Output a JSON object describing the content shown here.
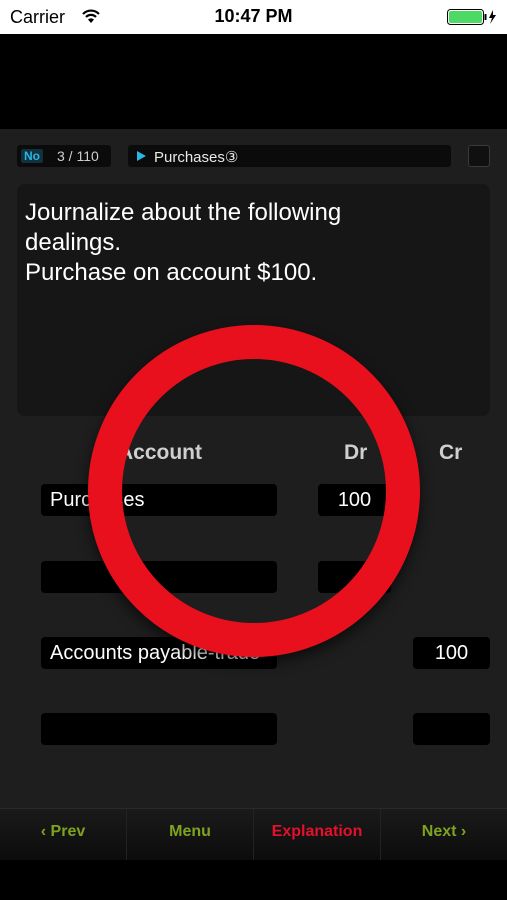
{
  "status_bar": {
    "carrier": "Carrier",
    "time": "10:47 PM"
  },
  "header": {
    "no_label": "No",
    "count": "3 / 110",
    "category": "Purchases③"
  },
  "question": {
    "text": "Journalize about the following\ndealings.\nPurchase on account $100."
  },
  "columns": {
    "account": "Account",
    "dr": "Dr",
    "cr": "Cr"
  },
  "entries": [
    {
      "account": "Purchases",
      "dr": "100",
      "cr": ""
    },
    {
      "account": "",
      "dr": "",
      "cr": ""
    },
    {
      "account": "Accounts payable-trade",
      "dr": "",
      "cr": "100"
    },
    {
      "account": "",
      "dr": "",
      "cr": ""
    }
  ],
  "toolbar": {
    "prev": "‹ Prev",
    "menu": "Menu",
    "explanation": "Explanation",
    "next": "Next ›"
  },
  "colors": {
    "accent": "#2bb6e6",
    "nav_green": "#7fa31e",
    "explanation_red": "#e5102b",
    "mark_red": "#e8101d"
  },
  "result_mark": "correct-circle"
}
